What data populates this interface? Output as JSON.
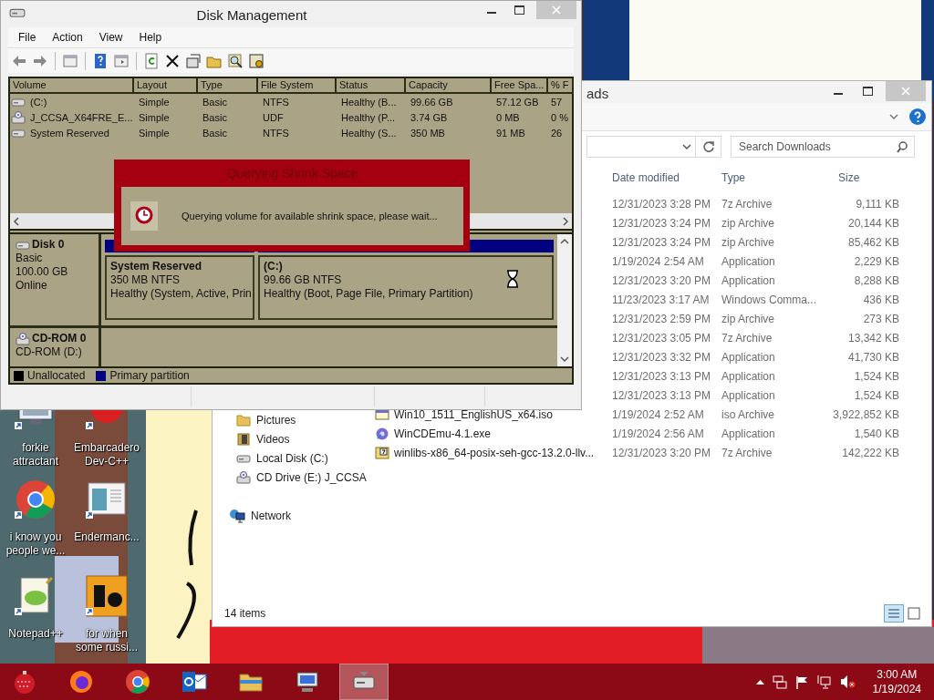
{
  "desktop_icons": [
    {
      "label": "forkie attractant",
      "kind": "monitor"
    },
    {
      "label": "Embarcadero Dev-C++",
      "kind": "ide"
    },
    {
      "label": "i know you people we...",
      "kind": "browser"
    },
    {
      "label": "Endermanc...",
      "kind": "window"
    },
    {
      "label": "Notepad++",
      "kind": "notepad"
    },
    {
      "label": "for when some russi...",
      "kind": "tile"
    }
  ],
  "explorer": {
    "title": "ads",
    "search": {
      "placeholder": "Search Downloads"
    },
    "nav": [
      {
        "label": "Pictures",
        "kind": "pictures"
      },
      {
        "label": "Videos",
        "kind": "videos"
      },
      {
        "label": "Local Disk (C:)",
        "kind": "disk"
      },
      {
        "label": "CD Drive (E:) J_CCSA",
        "kind": "cd"
      },
      {
        "label": "Network",
        "kind": "network"
      }
    ],
    "columns": [
      "Date modified",
      "Type",
      "Size"
    ],
    "rows": [
      {
        "date": "12/31/2023 3:28 PM",
        "type": "7z Archive",
        "size": "9,111 KB"
      },
      {
        "date": "12/31/2023 3:24 PM",
        "type": "zip Archive",
        "size": "20,144 KB"
      },
      {
        "date": "12/31/2023 3:24 PM",
        "type": "zip Archive",
        "size": "85,462 KB"
      },
      {
        "date": "1/19/2024 2:54 AM",
        "type": "Application",
        "size": "2,229 KB"
      },
      {
        "date": "12/31/2023 3:20 PM",
        "type": "Application",
        "size": "8,288 KB"
      },
      {
        "date": "11/23/2023 3:17 AM",
        "type": "Windows Comma...",
        "size": "436 KB"
      },
      {
        "date": "12/31/2023 2:59 PM",
        "type": "zip Archive",
        "size": "273 KB"
      },
      {
        "date": "12/31/2023 3:05 PM",
        "type": "7z Archive",
        "size": "13,342 KB"
      },
      {
        "date": "12/31/2023 3:32 PM",
        "type": "Application",
        "size": "41,730 KB"
      },
      {
        "date": "12/31/2023 3:13 PM",
        "type": "Application",
        "size": "1,524 KB"
      },
      {
        "date": "12/31/2023 3:13 PM",
        "type": "Application",
        "size": "1,524 KB"
      },
      {
        "name": "Win10_1511_EnglishUS_x64.iso",
        "kind": "iso",
        "date": "1/19/2024 2:52 AM",
        "type": "iso Archive",
        "size": "3,922,852 KB"
      },
      {
        "name": "WinCDEmu-4.1.exe",
        "kind": "exe",
        "date": "1/19/2024 2:56 AM",
        "type": "Application",
        "size": "1,540 KB"
      },
      {
        "name": "winlibs-x86_64-posix-seh-gcc-13.2.0-llv...",
        "kind": "archive",
        "date": "12/31/2023 3:20 PM",
        "type": "7z Archive",
        "size": "142,222 KB"
      }
    ],
    "status": "14 items"
  },
  "disk_management": {
    "title": "Disk Management",
    "menu": [
      "File",
      "Action",
      "View",
      "Help"
    ],
    "columns": [
      "Volume",
      "Layout",
      "Type",
      "File System",
      "Status",
      "Capacity",
      "Free Spa...",
      "% F"
    ],
    "volumes": [
      {
        "kind": "disk",
        "cells": [
          "(C:)",
          "Simple",
          "Basic",
          "NTFS",
          "Healthy (B...",
          "99.66 GB",
          "57.12 GB",
          "57"
        ]
      },
      {
        "kind": "cd",
        "cells": [
          "J_CCSA_X64FRE_E...",
          "Simple",
          "Basic",
          "UDF",
          "Healthy (P...",
          "3.74 GB",
          "0 MB",
          "0 %"
        ]
      },
      {
        "kind": "disk",
        "cells": [
          "System Reserved",
          "Simple",
          "Basic",
          "NTFS",
          "Healthy (S...",
          "350 MB",
          "91 MB",
          "26"
        ]
      }
    ],
    "disks": [
      {
        "kind": "disk",
        "name": "Disk 0",
        "lines": [
          "Basic",
          "100.00 GB",
          "Online"
        ],
        "partitions": [
          {
            "name": "System Reserved",
            "size": "350 MB NTFS",
            "status": "Healthy (System, Active, Prin",
            "busy": false
          },
          {
            "name": "(C:)",
            "size": "99.66 GB NTFS",
            "status": "Healthy (Boot, Page File, Primary Partition)",
            "busy": true
          }
        ]
      },
      {
        "kind": "cd",
        "name": "CD-ROM 0",
        "lines": [
          "CD-ROM (D:)"
        ]
      }
    ],
    "legend": [
      {
        "label": "Unallocated",
        "color": "#000000"
      },
      {
        "label": "Primary partition",
        "color": "#000080"
      }
    ],
    "dialog": {
      "title": "Querying Shrink Space",
      "message": "Querying volume for available shrink space, please wait..."
    }
  },
  "taskbar": {
    "items": [
      {
        "kind": "ornament",
        "selected": false
      },
      {
        "kind": "fox",
        "selected": false
      },
      {
        "kind": "browser",
        "selected": false
      },
      {
        "kind": "mail",
        "selected": false
      },
      {
        "kind": "folder",
        "selected": false
      },
      {
        "kind": "computer",
        "selected": false
      },
      {
        "kind": "disk",
        "selected": true
      }
    ],
    "time": "3:00 AM",
    "date": "1/19/2024"
  }
}
